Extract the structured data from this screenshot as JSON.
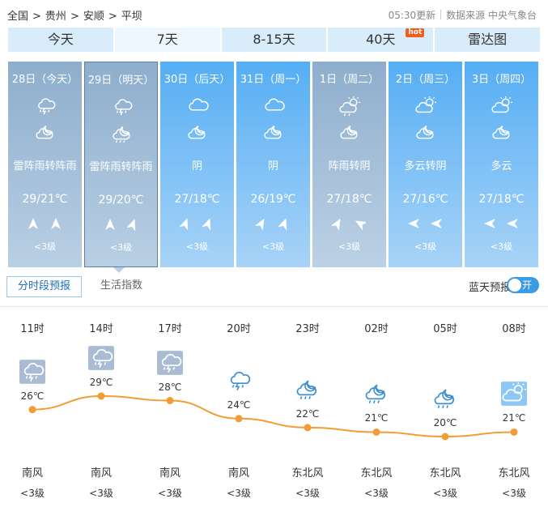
{
  "breadcrumb": [
    "全国",
    "贵州",
    "安顺",
    "平坝"
  ],
  "breadcrumb_sep": ">",
  "update_time": "05:30更新",
  "source": "数据来源 中央气象台",
  "tabs": [
    {
      "label": "今天"
    },
    {
      "label": "7天"
    },
    {
      "label": "8-15天"
    },
    {
      "label": "40天"
    },
    {
      "label": "雷达图"
    }
  ],
  "hot_badge": "hot",
  "days": [
    {
      "date": "28日（今天）",
      "icon_day": "thunder-shower-icon",
      "icon_night": "cloudy-moon-icon",
      "desc": "雷阵雨转阵雨",
      "temp": "29/21℃",
      "wind_level": "<3级"
    },
    {
      "date": "29日（明天）",
      "icon_day": "thunder-shower-icon",
      "icon_night": "shower-night-icon",
      "desc": "雷阵雨转阵雨",
      "temp": "29/20℃",
      "wind_level": "<3级"
    },
    {
      "date": "30日（后天）",
      "icon_day": "overcast-icon",
      "icon_night": "cloudy-moon-icon",
      "desc": "阴",
      "temp": "27/18℃",
      "wind_level": "<3级"
    },
    {
      "date": "31日（周一）",
      "icon_day": "overcast-icon",
      "icon_night": "cloudy-moon-icon",
      "desc": "阴",
      "temp": "26/19℃",
      "wind_level": "<3级"
    },
    {
      "date": "1日（周二）",
      "icon_day": "shower-sun-icon",
      "icon_night": "cloudy-moon-icon",
      "desc": "阵雨转阴",
      "temp": "27/18℃",
      "wind_level": "<3级"
    },
    {
      "date": "2日（周三）",
      "icon_day": "partly-cloudy-icon",
      "icon_night": "cloudy-moon-icon",
      "desc": "多云转阴",
      "temp": "27/16℃",
      "wind_level": "<3级"
    },
    {
      "date": "3日（周四）",
      "icon_day": "partly-cloudy-icon",
      "icon_night": "cloudy-moon-icon",
      "desc": "多云",
      "temp": "27/18℃",
      "wind_level": "<3级"
    }
  ],
  "subtabs": {
    "hourly": "分时段预报",
    "life": "生活指数"
  },
  "sky_report": {
    "label": "蓝天预报",
    "toggle": "开"
  },
  "hourly": [
    {
      "time": "11时",
      "temp": 26,
      "temp_label": "26℃",
      "icon": "thunder-shower-icon",
      "wind": "南风",
      "level": "<3级"
    },
    {
      "time": "14时",
      "temp": 29,
      "temp_label": "29℃",
      "icon": "thunder-shower-icon",
      "wind": "南风",
      "level": "<3级"
    },
    {
      "time": "17时",
      "temp": 28,
      "temp_label": "28℃",
      "icon": "thunder-shower-icon",
      "wind": "南风",
      "level": "<3级"
    },
    {
      "time": "20时",
      "temp": 24,
      "temp_label": "24℃",
      "icon": "thunder-shower-icon",
      "wind": "南风",
      "level": "<3级"
    },
    {
      "time": "23时",
      "temp": 22,
      "temp_label": "22℃",
      "icon": "shower-night-icon",
      "wind": "东北风",
      "level": "<3级"
    },
    {
      "time": "02时",
      "temp": 21,
      "temp_label": "21℃",
      "icon": "shower-night-icon",
      "wind": "东北风",
      "level": "<3级"
    },
    {
      "time": "05时",
      "temp": 20,
      "temp_label": "20℃",
      "icon": "shower-night-icon",
      "wind": "东北风",
      "level": "<3级"
    },
    {
      "time": "08时",
      "temp": 21,
      "temp_label": "21℃",
      "icon": "partly-cloudy-icon",
      "wind": "东北风",
      "level": "<3级"
    }
  ],
  "colors": {
    "accent": "#3a9be6",
    "line": "#f39c34",
    "tab": "#d8ecfa",
    "hot": "#f45b1d"
  }
}
